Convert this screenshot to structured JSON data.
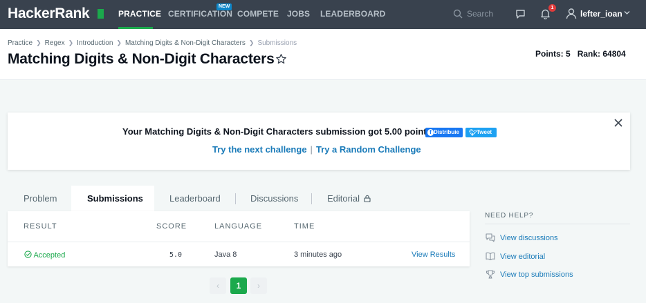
{
  "nav": {
    "logo": "HackerRank",
    "items": [
      {
        "label": "PRACTICE"
      },
      {
        "label": "CERTIFICATION"
      },
      {
        "label": "COMPETE"
      },
      {
        "label": "JOBS"
      },
      {
        "label": "LEADERBOARD"
      }
    ],
    "new_badge": "NEW",
    "search_placeholder": "Search",
    "notification_count": "1",
    "username": "lefter_ioan",
    "accent": "#1ba94c"
  },
  "breadcrumb": [
    "Practice",
    "Regex",
    "Introduction",
    "Matching Digits & Non-Digit Characters",
    "Submissions"
  ],
  "page": {
    "title": "Matching Digits & Non-Digit Characters",
    "points_label": "Points: 5",
    "rank_label": "Rank: 64804"
  },
  "banner": {
    "message": "Your Matching Digits & Non-Digit Characters submission got 5.00 points.",
    "facebook_label": "Distribuie",
    "tweet_label": "Tweet",
    "next_challenge": "Try the next challenge",
    "separator": "|",
    "random_challenge": "Try a Random Challenge"
  },
  "tabs": [
    {
      "label": "Problem"
    },
    {
      "label": "Submissions"
    },
    {
      "label": "Leaderboard"
    },
    {
      "label": "Discussions"
    },
    {
      "label": "Editorial"
    }
  ],
  "table": {
    "headers": [
      "RESULT",
      "SCORE",
      "LANGUAGE",
      "TIME"
    ],
    "rows": [
      {
        "result": "Accepted",
        "score": "5.0",
        "language": "Java 8",
        "time": "3 minutes ago",
        "action": "View Results"
      }
    ]
  },
  "pagination": {
    "current": "1",
    "prev": "‹",
    "next": "›"
  },
  "help": {
    "title": "NEED HELP?",
    "links": [
      "View discussions",
      "View editorial",
      "View top submissions"
    ]
  }
}
